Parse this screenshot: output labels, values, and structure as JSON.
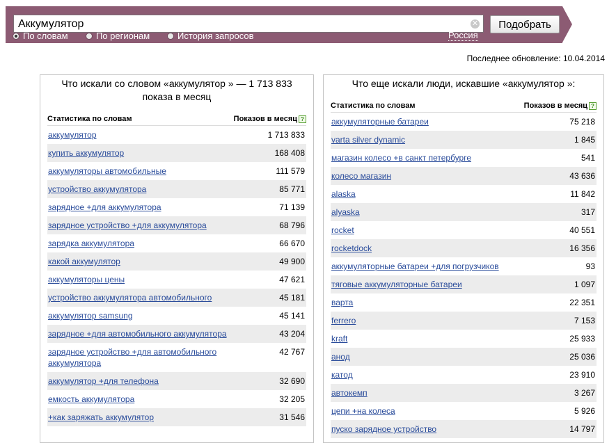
{
  "search": {
    "query": "Аккумулятор",
    "submit_label": "Подобрать",
    "region": "Россия",
    "modes": [
      {
        "label": "По словам",
        "checked": true
      },
      {
        "label": "По регионам",
        "checked": false
      },
      {
        "label": "История запросов",
        "checked": false
      }
    ]
  },
  "last_update": "Последнее обновление: 10.04.2014",
  "left_panel": {
    "title": "Что искали со словом «аккумулятор » — 1 713 833 показа в месяц",
    "col_phrase": "Статистика по словам",
    "col_count": "Показов в месяц",
    "rows": [
      {
        "phrase": "аккумулятор",
        "count": "1 713 833"
      },
      {
        "phrase": "купить аккумулятор",
        "count": "168 408"
      },
      {
        "phrase": "аккумуляторы автомобильные",
        "count": "111 579"
      },
      {
        "phrase": "устройство аккумулятора",
        "count": "85 771"
      },
      {
        "phrase": "зарядное +для аккумулятора",
        "count": "71 139"
      },
      {
        "phrase": "зарядное устройство +для аккумулятора",
        "count": "68 796"
      },
      {
        "phrase": "зарядка аккумулятора",
        "count": "66 670"
      },
      {
        "phrase": "какой аккумулятор",
        "count": "49 900"
      },
      {
        "phrase": "аккумуляторы цены",
        "count": "47 621"
      },
      {
        "phrase": "устройство аккумулятора автомобильного",
        "count": "45 181"
      },
      {
        "phrase": "аккумулятор samsung",
        "count": "45 141"
      },
      {
        "phrase": "зарядное +для автомобильного аккумулятора",
        "count": "43 204"
      },
      {
        "phrase": "зарядное устройство +для автомобильного аккумулятора",
        "count": "42 767"
      },
      {
        "phrase": "аккумулятор +для телефона",
        "count": "32 690"
      },
      {
        "phrase": "емкость аккумулятора",
        "count": "32 205"
      },
      {
        "phrase": "+как заряжать аккумулятор",
        "count": "31 546"
      }
    ]
  },
  "right_panel": {
    "title": "Что еще искали люди, искавшие «аккумулятор »:",
    "col_phrase": "Статистика по словам",
    "col_count": "Показов в месяц",
    "rows": [
      {
        "phrase": "аккумуляторные батареи",
        "count": "75 218"
      },
      {
        "phrase": "varta silver dynamic",
        "count": "1 845"
      },
      {
        "phrase": "магазин колесо +в санкт петербурге",
        "count": "541"
      },
      {
        "phrase": "колесо магазин",
        "count": "43 636"
      },
      {
        "phrase": "alaska",
        "count": "11 842"
      },
      {
        "phrase": "alyaska",
        "count": "317"
      },
      {
        "phrase": "rocket",
        "count": "40 551"
      },
      {
        "phrase": "rocketdock",
        "count": "16 356"
      },
      {
        "phrase": "аккумуляторные батареи +для погрузчиков",
        "count": "93"
      },
      {
        "phrase": "тяговые аккумуляторные батареи",
        "count": "1 097"
      },
      {
        "phrase": "варта",
        "count": "22 351"
      },
      {
        "phrase": "ferrero",
        "count": "7 153"
      },
      {
        "phrase": "kraft",
        "count": "25 933"
      },
      {
        "phrase": "анод",
        "count": "25 036"
      },
      {
        "phrase": "катод",
        "count": "23 910"
      },
      {
        "phrase": "автокемп",
        "count": "3 267"
      },
      {
        "phrase": "цепи +на колеса",
        "count": "5 926"
      },
      {
        "phrase": "пуско зарядное устройство",
        "count": "14 797"
      }
    ]
  }
}
